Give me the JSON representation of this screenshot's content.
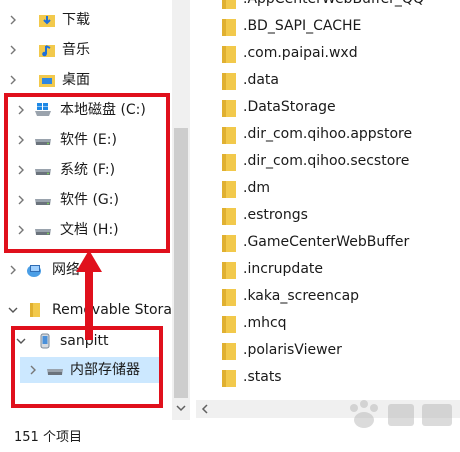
{
  "nav": {
    "items": [
      {
        "label": "下载",
        "icon": "download-folder-icon",
        "chevron": true
      },
      {
        "label": "音乐",
        "icon": "music-folder-icon",
        "chevron": true
      },
      {
        "label": "桌面",
        "icon": "desktop-folder-icon",
        "chevron": true
      },
      {
        "label": "本地磁盘 (C:)",
        "icon": "windows-drive-icon",
        "chevron": true
      },
      {
        "label": "软件 (E:)",
        "icon": "drive-icon",
        "chevron": true
      },
      {
        "label": "系统 (F:)",
        "icon": "drive-icon",
        "chevron": true
      },
      {
        "label": "软件 (G:)",
        "icon": "drive-icon",
        "chevron": true
      },
      {
        "label": "文档 (H:)",
        "icon": "drive-icon",
        "chevron": true
      },
      {
        "label": "网络",
        "icon": "network-icon",
        "chevron": true
      },
      {
        "label": "Removable Stora",
        "icon": "folder-icon",
        "chevron": true,
        "expanded": true
      },
      {
        "label": "sanpitt",
        "icon": "phone-icon",
        "chevron": true,
        "expanded": true
      },
      {
        "label": "内部存储器",
        "icon": "storage-icon",
        "chevron": true,
        "selected": true
      }
    ]
  },
  "files": {
    "items": [
      ".AppCenterWebBuffer_QQ",
      ".BD_SAPI_CACHE",
      ".com.paipai.wxd",
      ".data",
      ".DataStorage",
      ".dir_com.qihoo.appstore",
      ".dir_com.qihoo.secstore",
      ".dm",
      ".estrongs",
      ".GameCenterWebBuffer",
      ".incrupdate",
      ".kaka_screencap",
      ".mhcq",
      ".polarisViewer",
      ".stats"
    ]
  },
  "status": {
    "count_text": "151 个项目"
  },
  "colors": {
    "annotation": "#e0101c",
    "selection": "#cce8ff",
    "folder": "#f2c94c"
  }
}
